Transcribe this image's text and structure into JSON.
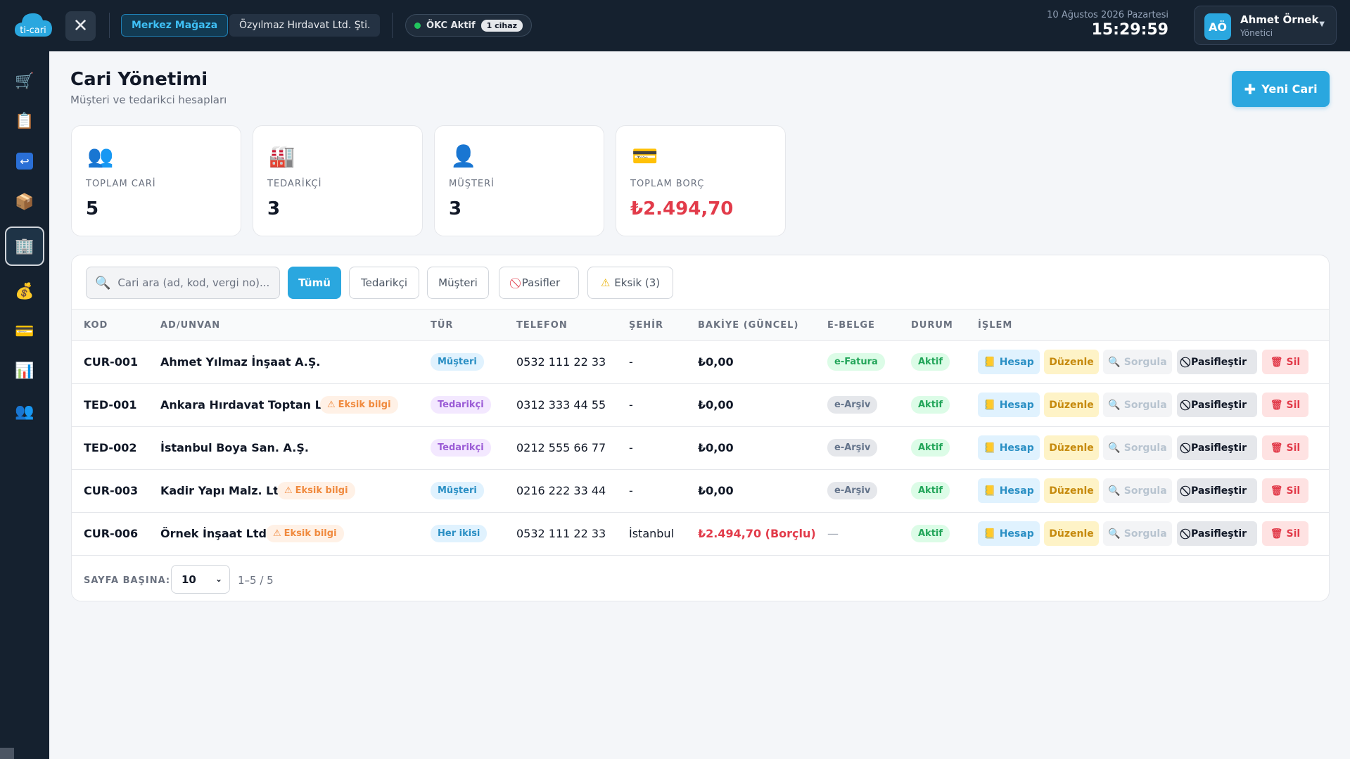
{
  "topbar": {
    "logo_text": "ti-cari",
    "store": "Merkez Mağaza",
    "company": "Özyılmaz Hırdavat Ltd. Şti.",
    "okc_label": "ÖKC Aktif",
    "okc_count": "1 cihaz",
    "date": "10 Ağustos 2026 Pazartesi",
    "time": "15:29:59",
    "user": {
      "initials": "AÖ",
      "name": "Ahmet Örnek",
      "role": "Yönetici"
    }
  },
  "sidebar": {
    "items": [
      {
        "icon": "cart-icon",
        "glyph": "🛒"
      },
      {
        "icon": "clipboard-icon",
        "glyph": "📋"
      },
      {
        "icon": "return-icon",
        "glyph": "↩"
      },
      {
        "icon": "box-icon",
        "glyph": "📦"
      },
      {
        "icon": "building-icon",
        "glyph": "🏢",
        "active": true
      },
      {
        "icon": "money-bag-icon",
        "glyph": "💰"
      },
      {
        "icon": "card-icon",
        "glyph": "💳"
      },
      {
        "icon": "chart-icon",
        "glyph": "📊"
      },
      {
        "icon": "users-icon",
        "glyph": "👥"
      }
    ]
  },
  "page": {
    "title": "Cari Yönetimi",
    "subtitle": "Müşteri ve tedarikci hesapları",
    "new_button": "Yeni Cari"
  },
  "stats": [
    {
      "icon": "👥",
      "label": "TOPLAM CARİ",
      "value": "5"
    },
    {
      "icon": "🏭",
      "label": "TEDARİKÇİ",
      "value": "3"
    },
    {
      "icon": "👤",
      "label": "MÜŞTERİ",
      "value": "3"
    },
    {
      "icon": "💳",
      "label": "TOPLAM BORÇ",
      "value": "₺2.494,70"
    }
  ],
  "filters": {
    "search_placeholder": "Cari ara (ad, kod, vergi no)...",
    "all": "Tümü",
    "supplier": "Tedarikçi",
    "customer": "Müşteri",
    "passive": "Pasifler",
    "missing": "Eksik (3)"
  },
  "table": {
    "headers": [
      "KOD",
      "AD/UNVAN",
      "TÜR",
      "TELEFON",
      "ŞEHİR",
      "BAKİYE (GÜNCEL)",
      "E-BELGE",
      "DURUM",
      "İŞLEM"
    ],
    "missing_label": "Eksik bilgi",
    "actions": {
      "hesap": "Hesap",
      "duzenle": "Düzenle",
      "sorgula": "Sorgula",
      "pasif": "Pasifleştir",
      "sil": "Sil"
    },
    "rows": [
      {
        "code": "CUR-001",
        "name": "Ahmet Yılmaz İnşaat A.Ş.",
        "type": "Müşteri",
        "phone": "0532 111 22 33",
        "city": "-",
        "balance": "₺0,00",
        "ebelge": "e-Fatura",
        "status": "Aktif"
      },
      {
        "code": "TED-001",
        "name": "Ankara Hırdavat Toptan Ltd.",
        "type": "Tedarikçi",
        "phone": "0312 333 44 55",
        "city": "-",
        "balance": "₺0,00",
        "ebelge": "e-Arşiv",
        "status": "Aktif"
      },
      {
        "code": "TED-002",
        "name": "İstanbul Boya San. A.Ş.",
        "type": "Tedarikçi",
        "phone": "0212 555 66 77",
        "city": "-",
        "balance": "₺0,00",
        "ebelge": "e-Arşiv",
        "status": "Aktif"
      },
      {
        "code": "CUR-003",
        "name": "Kadir Yapı Malz. Ltd.",
        "type": "Müşteri",
        "phone": "0216 222 33 44",
        "city": "-",
        "balance": "₺0,00",
        "ebelge": "e-Arşiv",
        "status": "Aktif"
      },
      {
        "code": "CUR-006",
        "name": "Örnek İnşaat Ltd.",
        "type": "Her ikisi",
        "phone": "0532 111 22 33",
        "city": "İstanbul",
        "balance": "₺2.494,70 (Borçlu)",
        "ebelge": "—",
        "status": "Aktif"
      }
    ]
  },
  "pagination": {
    "per_page_label": "SAYFA BAŞINA:",
    "per_page": "10",
    "range": "1–5 / 5"
  }
}
